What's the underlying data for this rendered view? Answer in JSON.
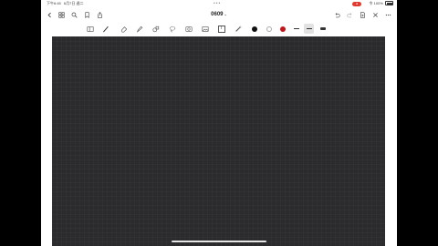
{
  "status_bar": {
    "time": "下午6:45",
    "date": "6月7日 週二",
    "record_label": "●",
    "battery_text": "100%",
    "wifi_text": "令",
    "more_dots": "•••"
  },
  "nav": {
    "document_title": "0609",
    "title_chevron": "⌄",
    "icons": [
      "back-icon",
      "grid-icon",
      "search-icon",
      "bookmark-icon",
      "share-icon",
      "undo-icon",
      "redo-icon",
      "add-page-icon",
      "close-icon",
      "more-icon"
    ]
  },
  "toolbar": {
    "tools": [
      "reader-icon",
      "pen-icon",
      "eraser-icon",
      "highlighter-icon",
      "shapes-icon",
      "lasso-icon",
      "image-icon",
      "camera-icon",
      "text-icon",
      "laser-pointer-icon"
    ],
    "text_tool_label": "T",
    "colors": [
      "#111111",
      "#ffffff",
      "#c4141c"
    ],
    "selected_stroke": "medium"
  },
  "canvas": {
    "background": "#2b2b2d",
    "template": "grid"
  }
}
